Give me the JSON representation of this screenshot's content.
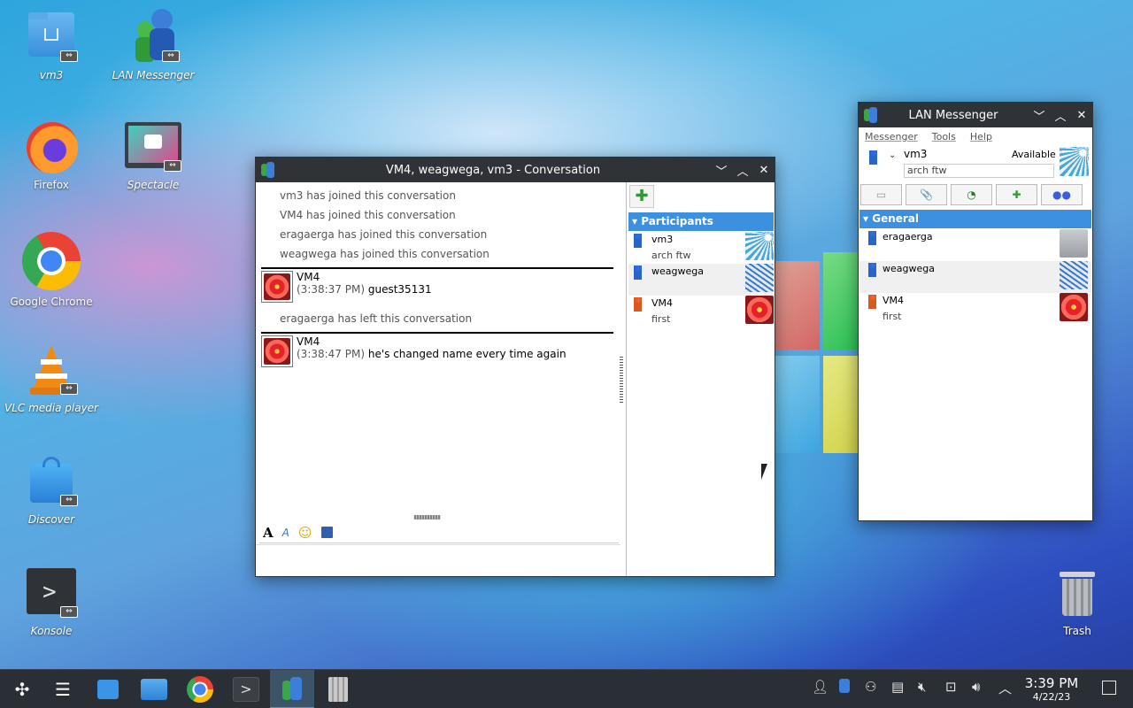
{
  "desktop_icons": [
    {
      "label": "vm3",
      "icon": "folder-home-icon"
    },
    {
      "label": "LAN Messenger",
      "icon": "lan-messenger-icon"
    },
    {
      "label": "Firefox",
      "icon": "firefox-icon"
    },
    {
      "label": "Spectacle",
      "icon": "spectacle-icon"
    },
    {
      "label": "Google Chrome",
      "icon": "chrome-icon"
    },
    {
      "label": "VLC media player",
      "icon": "vlc-icon"
    },
    {
      "label": "Discover",
      "icon": "discover-icon"
    },
    {
      "label": "Konsole",
      "icon": "konsole-icon"
    },
    {
      "label": "Trash",
      "icon": "trash-icon"
    }
  ],
  "conversation": {
    "title": "VM4, weagwega, vm3 - Conversation",
    "system_messages": [
      "vm3 has joined this conversation",
      "VM4 has joined this conversation",
      "eragaerga has joined this conversation",
      "weagwega has joined this conversation",
      "eragaerga has left this conversation"
    ],
    "messages": [
      {
        "sender": "VM4",
        "time": "(3:38:37 PM)",
        "text": "guest35131"
      },
      {
        "sender": "VM4",
        "time": "(3:38:47 PM)",
        "text": "he's changed name every time again"
      }
    ],
    "format_tools": [
      "font-icon",
      "font-color-icon",
      "smiley-icon",
      "save-icon"
    ],
    "participants_header": "Participants",
    "participants": [
      {
        "name": "vm3",
        "note": "arch ftw",
        "status_color": "blue",
        "picture": "sky"
      },
      {
        "name": "weagwega",
        "note": "",
        "status_color": "blue",
        "picture": "bridge"
      },
      {
        "name": "VM4",
        "note": "first",
        "status_color": "orange",
        "picture": "flower"
      }
    ]
  },
  "messenger": {
    "title": "LAN Messenger",
    "menu": [
      "Messenger",
      "Tools",
      "Help"
    ],
    "user_name": "vm3",
    "status": "Available",
    "status_note": "arch ftw",
    "toolbar": [
      "broadcast-icon",
      "file-icon",
      "rss-icon",
      "add-contact-icon",
      "group-chat-icon"
    ],
    "group_name": "General",
    "contacts": [
      {
        "name": "eragaerga",
        "note": "",
        "status_color": "blue",
        "picture": "default"
      },
      {
        "name": "weagwega",
        "note": "",
        "status_color": "blue",
        "picture": "bridge"
      },
      {
        "name": "VM4",
        "note": "first",
        "status_color": "orange",
        "picture": "flower"
      }
    ]
  },
  "taskbar": {
    "clock_time": "3:39 PM",
    "clock_date": "4/22/23"
  }
}
